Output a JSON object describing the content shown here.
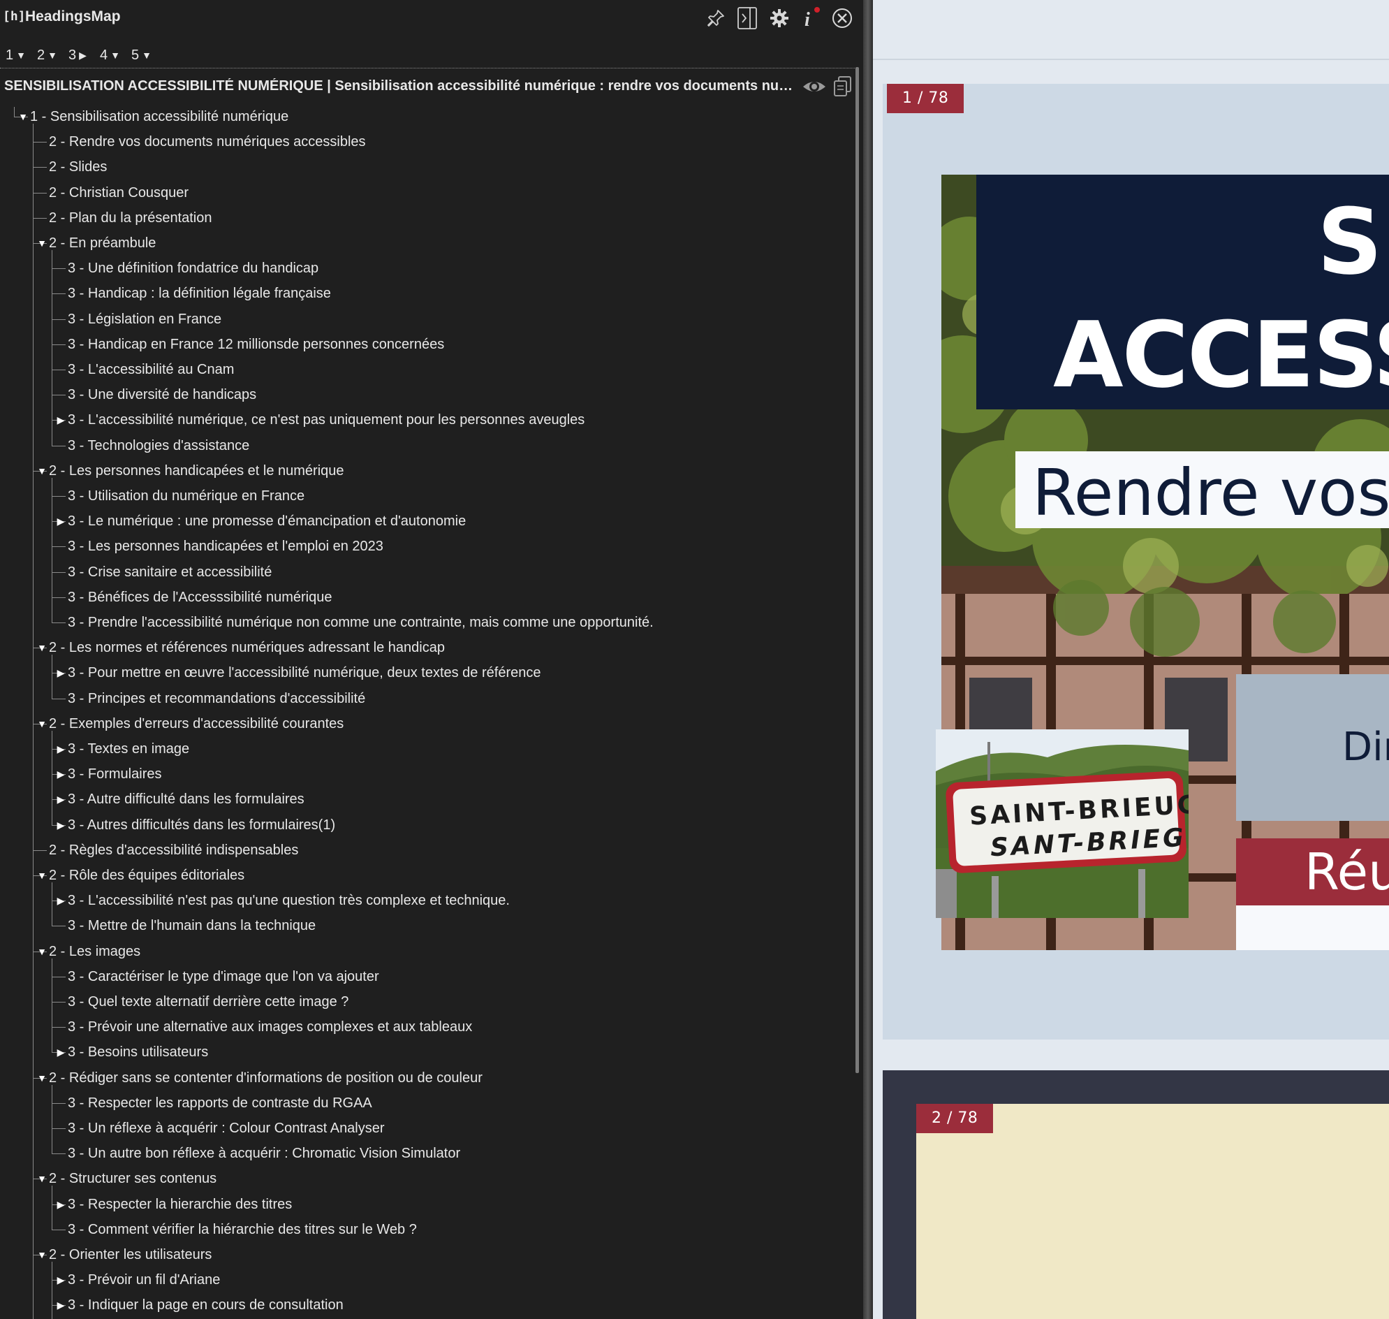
{
  "app": {
    "logo_text": "[h]",
    "title": "HeadingsMap",
    "icons": [
      "pin-icon",
      "dock-side-icon",
      "gear-icon",
      "info-icon",
      "close-icon"
    ]
  },
  "levels": [
    {
      "label": "1",
      "state": "expanded"
    },
    {
      "label": "2",
      "state": "expanded"
    },
    {
      "label": "3",
      "state": "collapsed"
    },
    {
      "label": "4",
      "state": "expanded"
    },
    {
      "label": "5",
      "state": "expanded"
    }
  ],
  "document_title": "SENSIBILISATION ACCESSIBILITÉ NUMÉRIQUE | Sensibilisation accessibilité numérique : rendre vos documents numé…",
  "headings": [
    {
      "text": "1 - Sensibilisation accessibilité numérique",
      "level": 1,
      "toggle": "expanded"
    },
    {
      "text": "2 - Rendre vos documents numériques accessibles",
      "level": 2,
      "toggle": "none"
    },
    {
      "text": "2 - Slides",
      "level": 2,
      "toggle": "none"
    },
    {
      "text": "2 - Christian Cousquer",
      "level": 2,
      "toggle": "none"
    },
    {
      "text": "2 - Plan du la présentation",
      "level": 2,
      "toggle": "none"
    },
    {
      "text": "2 - En préambule",
      "level": 2,
      "toggle": "expanded"
    },
    {
      "text": "3 - Une définition fondatrice du handicap",
      "level": 3,
      "toggle": "none"
    },
    {
      "text": "3 - Handicap : la définition légale française",
      "level": 3,
      "toggle": "none"
    },
    {
      "text": "3 - Législation en France",
      "level": 3,
      "toggle": "none"
    },
    {
      "text": "3 - Handicap en France 12 millionsde personnes concernées",
      "level": 3,
      "toggle": "none"
    },
    {
      "text": "3 - L'accessibilité au Cnam",
      "level": 3,
      "toggle": "none"
    },
    {
      "text": "3 - Une diversité de handicaps",
      "level": 3,
      "toggle": "none"
    },
    {
      "text": "3 - L'accessibilité numérique, ce n'est pas uniquement pour les personnes aveugles",
      "level": 3,
      "toggle": "collapsed"
    },
    {
      "text": "3 - Technologies d'assistance",
      "level": 3,
      "toggle": "none"
    },
    {
      "text": "2 - Les personnes handicapées et le numérique",
      "level": 2,
      "toggle": "expanded"
    },
    {
      "text": "3 - Utilisation du numérique en France",
      "level": 3,
      "toggle": "none"
    },
    {
      "text": "3 - Le numérique : une promesse d'émancipation et d'autonomie",
      "level": 3,
      "toggle": "collapsed"
    },
    {
      "text": "3 - Les personnes handicapées et l'emploi en 2023",
      "level": 3,
      "toggle": "none"
    },
    {
      "text": "3 - Crise sanitaire et accessibilité",
      "level": 3,
      "toggle": "none"
    },
    {
      "text": "3 - Bénéfices de l'Accesssibilité numérique",
      "level": 3,
      "toggle": "none"
    },
    {
      "text": "3 - Prendre l'accessibilité numérique non comme une contrainte, mais comme une opportunité.",
      "level": 3,
      "toggle": "none"
    },
    {
      "text": "2 - Les normes et références numériques adressant le handicap",
      "level": 2,
      "toggle": "expanded"
    },
    {
      "text": "3 - Pour mettre en œuvre l'accessibilité numérique, deux textes de référence",
      "level": 3,
      "toggle": "collapsed"
    },
    {
      "text": "3 - Principes et recommandations d'accessibilité",
      "level": 3,
      "toggle": "none"
    },
    {
      "text": "2 - Exemples d'erreurs d'accessibilité courantes",
      "level": 2,
      "toggle": "expanded"
    },
    {
      "text": "3 - Textes en image",
      "level": 3,
      "toggle": "collapsed"
    },
    {
      "text": "3 - Formulaires",
      "level": 3,
      "toggle": "collapsed"
    },
    {
      "text": "3 - Autre difficulté dans les formulaires",
      "level": 3,
      "toggle": "collapsed"
    },
    {
      "text": "3 - Autres difficultés dans les formulaires(1)",
      "level": 3,
      "toggle": "collapsed"
    },
    {
      "text": "2 - Règles d'accessibilité indispensables",
      "level": 2,
      "toggle": "none"
    },
    {
      "text": "2 - Rôle des équipes éditoriales",
      "level": 2,
      "toggle": "expanded"
    },
    {
      "text": "3 - L'accessibilité n'est pas qu'une question très complexe et technique.",
      "level": 3,
      "toggle": "collapsed"
    },
    {
      "text": "3 - Mettre de l'humain dans la technique",
      "level": 3,
      "toggle": "none"
    },
    {
      "text": "2 - Les images",
      "level": 2,
      "toggle": "expanded"
    },
    {
      "text": "3 - Caractériser le type d'image que l'on va ajouter",
      "level": 3,
      "toggle": "none"
    },
    {
      "text": "3 - Quel texte alternatif derrière cette image ?",
      "level": 3,
      "toggle": "none"
    },
    {
      "text": "3 - Prévoir une alternative aux images complexes et aux tableaux",
      "level": 3,
      "toggle": "none"
    },
    {
      "text": "3 - Besoins utilisateurs",
      "level": 3,
      "toggle": "collapsed"
    },
    {
      "text": "2 - Rédiger sans se contenter d'informations de position ou de couleur",
      "level": 2,
      "toggle": "expanded"
    },
    {
      "text": "3 - Respecter les rapports de contraste du RGAA",
      "level": 3,
      "toggle": "none"
    },
    {
      "text": "3 - Un réflexe à acquérir : Colour Contrast Analyser",
      "level": 3,
      "toggle": "none"
    },
    {
      "text": "3 - Un autre bon réflexe à acquérir : Chromatic Vision Simulator",
      "level": 3,
      "toggle": "none"
    },
    {
      "text": "2 - Structurer ses contenus",
      "level": 2,
      "toggle": "expanded"
    },
    {
      "text": "3 - Respecter la hierarchie des titres",
      "level": 3,
      "toggle": "collapsed"
    },
    {
      "text": "3 - Comment vérifier la hiérarchie des titres sur le Web ?",
      "level": 3,
      "toggle": "none"
    },
    {
      "text": "2 - Orienter les utilisateurs",
      "level": 2,
      "toggle": "expanded"
    },
    {
      "text": "3 - Prévoir un fil d'Ariane",
      "level": 3,
      "toggle": "collapsed"
    },
    {
      "text": "3 - Indiquer la page en cours de consultation",
      "level": 3,
      "toggle": "collapsed"
    }
  ],
  "slides": {
    "slide1": {
      "page_badge": "1 / 78",
      "title_line1": "SE",
      "title_line2": "ACCESS",
      "subtitle": "Rendre vos",
      "grey_box_text": "Dir",
      "red_box_text": "Réu",
      "sign_line1": "SAINT-BRIEUC",
      "sign_line2": "SANT-BRIEG"
    },
    "slide2": {
      "page_badge": "2 / 78"
    }
  },
  "colors": {
    "panel_bg": "#1f1f1f",
    "panel_text": "#e8e8e8",
    "badge_red": "#9b2d3b",
    "navy": "#0f1c38",
    "slide2_bg": "#f0e8c6",
    "notification_dot": "#d0202a"
  }
}
